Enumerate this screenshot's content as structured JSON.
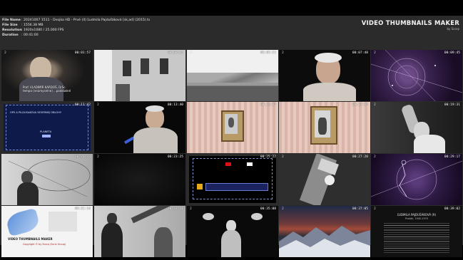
{
  "file_info": {
    "rows": [
      {
        "key": "File Name",
        "value": ": 20241007 1511 - Dvojka HD - Prvé (4) Ľudmila Pajdušáková [sk,ad] (2015).ts"
      },
      {
        "key": "File Size",
        "value": ": 1556.38 MB"
      },
      {
        "key": "Resolution",
        "value": ": 1920x1080 / 25.000 FPS"
      },
      {
        "key": "Duration",
        "value": ": 00:41:00"
      }
    ]
  },
  "brand": {
    "title": "VIDEO THUMBNAILS MAKER",
    "subtitle": "by Scorp"
  },
  "tiles": [
    {
      "time": "00:01:57",
      "tag": "2",
      "caption_lines": [
        "Prof. VLADIMÍR KARDOŠ, DrSc.",
        "tempo (neúmyselne) ...podstatné"
      ]
    },
    {
      "time": "00:03:54",
      "tag": ""
    },
    {
      "time": "00:05:51",
      "tag": "2"
    },
    {
      "time": "00:07:48",
      "tag": "2"
    },
    {
      "time": "00:09:45",
      "tag": "2"
    },
    {
      "time": "00:11:42",
      "tag": "",
      "text_lines": [
        "OPS A PILDUSAKOVA SEVERNEJ OBLOHY",
        "PLANETA"
      ]
    },
    {
      "time": "00:13:40",
      "tag": "2"
    },
    {
      "time": "00:15:37",
      "tag": "2"
    },
    {
      "time": "00:17:34",
      "tag": "2"
    },
    {
      "time": "00:19:31",
      "tag": "2"
    },
    {
      "time": "00:21:28",
      "tag": "2"
    },
    {
      "time": "00:23:25",
      "tag": "2"
    },
    {
      "time": "00:25:22",
      "tag": ""
    },
    {
      "time": "00:27:20",
      "tag": "2"
    },
    {
      "time": "00:29:17",
      "tag": "2"
    },
    {
      "time": "00:31:14",
      "tag": "",
      "logo_lines": [
        "VIDEO THUMBNAILS MAKER",
        "Copyright © by Scorp (Scriz Group)"
      ]
    },
    {
      "time": "00:33:11",
      "tag": "2"
    },
    {
      "time": "00:35:08",
      "tag": "2"
    },
    {
      "time": "00:37:05",
      "tag": "2"
    },
    {
      "time": "00:39:02",
      "tag": "2",
      "text_lines": [
        "ĽUDMILA PAJDUŠÁKOVÁ (9)",
        "Pražák, 1945-1970"
      ]
    }
  ],
  "colors": {
    "background": "#2b2b2b",
    "letterbox": "#000000",
    "text": "#e6e6e6"
  }
}
